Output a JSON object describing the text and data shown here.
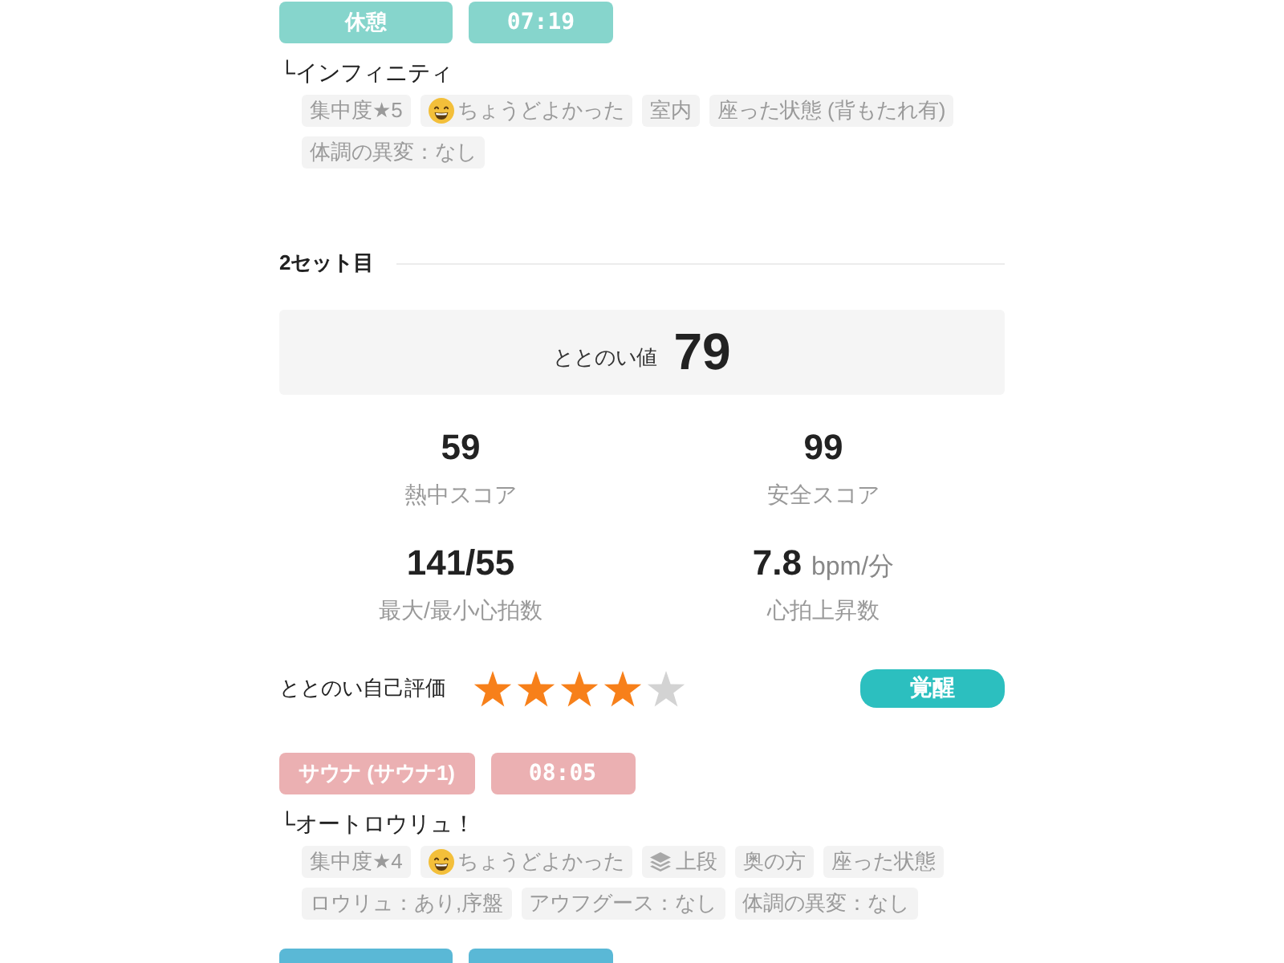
{
  "entries_above": [
    {
      "kind": "rest",
      "label": "休憩",
      "time": "07:19",
      "note": "└インフィニティ",
      "tags": [
        {
          "kind": "plain",
          "text": "集中度★5"
        },
        {
          "kind": "feeling",
          "text": "ちょうどよかった"
        },
        {
          "kind": "plain",
          "text": "室内"
        },
        {
          "kind": "plain",
          "text": "座った状態 (背もたれ有)"
        },
        {
          "kind": "plain",
          "text": "体調の異変：なし"
        }
      ]
    }
  ],
  "set_2": {
    "title": "2セット目",
    "score": {
      "label": "ととのい値",
      "value": "79"
    },
    "stats": [
      {
        "value": "59",
        "label": "熱中スコア"
      },
      {
        "value": "99",
        "label": "安全スコア"
      },
      {
        "value": "141/55",
        "label": "最大/最小心拍数"
      },
      {
        "value": "7.8",
        "unit": "bpm/分",
        "label": "心拍上昇数"
      }
    ],
    "self_rating": {
      "label": "ととのい自己評価",
      "stars": 4,
      "badge": "覚醒"
    },
    "entries": [
      {
        "kind": "sauna",
        "label": "サウナ (サウナ1)",
        "time": "08:05",
        "note": "└オートロウリュ！",
        "tags": [
          {
            "kind": "plain",
            "text": "集中度★4"
          },
          {
            "kind": "feeling",
            "text": "ちょうどよかった"
          },
          {
            "kind": "position",
            "text": "上段"
          },
          {
            "kind": "plain",
            "text": "奥の方"
          },
          {
            "kind": "plain",
            "text": "座った状態"
          },
          {
            "kind": "plain",
            "text": "ロウリュ：あり,序盤"
          },
          {
            "kind": "plain",
            "text": "アウフグース：なし"
          },
          {
            "kind": "plain",
            "text": "体調の異変：なし"
          }
        ]
      },
      {
        "kind": "water"
      }
    ]
  }
}
